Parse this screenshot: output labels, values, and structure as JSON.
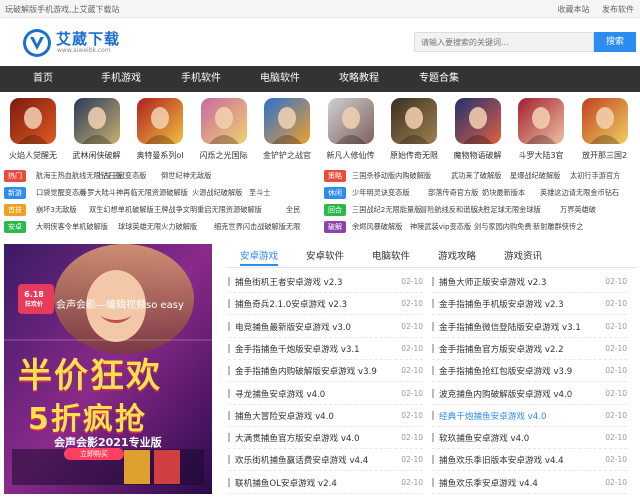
{
  "topbar": {
    "slogan": "玩破解版手机游戏,上艾葳下载站",
    "bookmark": "收藏本站",
    "publish": "发布软件"
  },
  "logo": {
    "name": "艾葳下载",
    "url_text": "www.aiweibk.com"
  },
  "search": {
    "placeholder": "请输入要搜索的关键词...",
    "button": "搜索"
  },
  "nav": [
    "首页",
    "手机游戏",
    "手机软件",
    "电脑软件",
    "攻略教程",
    "专题合集"
  ],
  "games": [
    {
      "name": "火焰人觉醒无",
      "c1": "#7a1a10",
      "c2": "#e05a20"
    },
    {
      "name": "武林闲侠破解",
      "c1": "#2a3a5a",
      "c2": "#c8b070"
    },
    {
      "name": "奥特曼系列ol",
      "c1": "#b02020",
      "c2": "#f0c040"
    },
    {
      "name": "闪烁之光国际",
      "c1": "#c86aa0",
      "c2": "#f0d070"
    },
    {
      "name": "金铲铲之战官",
      "c1": "#2a70d0",
      "c2": "#f0a030"
    },
    {
      "name": "新凡人修仙传",
      "c1": "#d0d0d0",
      "c2": "#806060"
    },
    {
      "name": "原始传奇无限",
      "c1": "#3a3020",
      "c2": "#a08050"
    },
    {
      "name": "魔物物语破解",
      "c1": "#203070",
      "c2": "#e06040"
    },
    {
      "name": "斗罗大陆3官",
      "c1": "#a02030",
      "c2": "#f0c0a0"
    },
    {
      "name": "放开那三国2",
      "c1": "#c04020",
      "c2": "#f0d060"
    }
  ],
  "tagrows": [
    {
      "tag": "热门",
      "color": "#e74c3c",
      "links": [
        "航海王热血航线无限钻石版",
        "上古王冠变态版",
        "倒世纪神无敌版"
      ],
      "tag2": "策略",
      "color2": "#e74c3c",
      "links2": [
        "三国杀移动版内购破解版",
        "武功来了破解版",
        "星爆战纪破解版",
        "太初行手游官方"
      ]
    },
    {
      "tag": "新游",
      "color": "#2d8cf0",
      "links": [
        "口袋觉醒变态版",
        "斗罗大陆斗神再临无限资源破解版",
        "火源战纪破解版",
        "圣斗士"
      ],
      "tag2": "休闲",
      "color2": "#2d8cf0",
      "links2": [
        "少年明灵诀变态版",
        "部落传奇官方版",
        "奶块最新版本",
        "英雄这边请无限金币钻石"
      ]
    },
    {
      "tag": "首技",
      "color": "#f0a020",
      "links": [
        "崩坏3无敌版",
        "双生幻想单机破解版",
        "王牌战争文明重启无限资源破解版",
        "全民"
      ],
      "tag2": "回合",
      "color2": "#2db84b",
      "links2": [
        "三国战纪2无限能量版",
        "冒险航线反和谐版",
        "决胜足球无限金球版",
        "万界英雄破"
      ]
    },
    {
      "tag": "安卓",
      "color": "#2db84b",
      "links": [
        "大明侠客令单机破解版",
        "球球英雄无限火力破解版",
        "细克世界闪击战破解版无限"
      ],
      "tag2": "破解",
      "color2": "#8e44ad",
      "links2": [
        "余烬风暴破解版",
        "神陵武装vip变态版",
        "剑与家园内购免费",
        "新射雕群侠传之"
      ]
    }
  ],
  "banner": {
    "badge_top": "6.18",
    "badge_bottom": "狂欢价",
    "tagline": "会声会影—编辑视频so easy",
    "headline_1": "半价狂欢",
    "headline_2": "5折疯抢",
    "product": "会声会影2021专业版",
    "product_sub": "立即购买"
  },
  "tabs": [
    "安卓游戏",
    "安卓软件",
    "电脑软件",
    "游戏攻略",
    "游戏资讯"
  ],
  "list_left": [
    {
      "title": "捕鱼街机王者安卓游戏 v2.3",
      "date": "02-10"
    },
    {
      "title": "捕鱼奇兵2.1.0安卓游戏 v2.3",
      "date": "02-10"
    },
    {
      "title": "电竞捕鱼最新版安卓游戏 v3.0",
      "date": "02-10"
    },
    {
      "title": "金手指捕鱼千炮版安卓游戏 v3.1",
      "date": "02-10"
    },
    {
      "title": "金手指捕鱼内购破解版安卓游戏 v3.9",
      "date": "02-10"
    },
    {
      "title": "寻龙捕鱼安卓游戏 v4.0",
      "date": "02-10"
    },
    {
      "title": "捕鱼大冒险安卓游戏 v4.0",
      "date": "02-10"
    },
    {
      "title": "大满贯捕鱼官方版安卓游戏 v4.0",
      "date": "02-10"
    },
    {
      "title": "欢乐街机捕鱼赢话费安卓游戏 v4.4",
      "date": "02-10"
    },
    {
      "title": "联机捕鱼OL安卓游戏 v2.4",
      "date": "02-10"
    }
  ],
  "list_right": [
    {
      "title": "捕鱼大师正版安卓游戏 v2.3",
      "date": "02-10",
      "hl": false
    },
    {
      "title": "金手指捕鱼手机版安卓游戏 v2.3",
      "date": "02-10",
      "hl": false
    },
    {
      "title": "金手指捕鱼微信登陆版安卓游戏 v3.1",
      "date": "02-10",
      "hl": false
    },
    {
      "title": "金手指捕鱼官方版安卓游戏 v2.2",
      "date": "02-10",
      "hl": false
    },
    {
      "title": "金手指捕鱼抢红包版安卓游戏 v3.9",
      "date": "02-10",
      "hl": false
    },
    {
      "title": "波克捕鱼内购破解版安卓游戏 v4.0",
      "date": "02-10",
      "hl": false
    },
    {
      "title": "经典千炮捕鱼安卓游戏 v4.0",
      "date": "02-10",
      "hl": true
    },
    {
      "title": "软玖捕鱼安卓游戏 v4.0",
      "date": "02-10",
      "hl": false
    },
    {
      "title": "捕鱼欢乐季旧版本安卓游戏 v4.4",
      "date": "02-10",
      "hl": false
    },
    {
      "title": "捕鱼欢乐季安卓游戏 v4.4",
      "date": "02-10",
      "hl": false
    }
  ]
}
